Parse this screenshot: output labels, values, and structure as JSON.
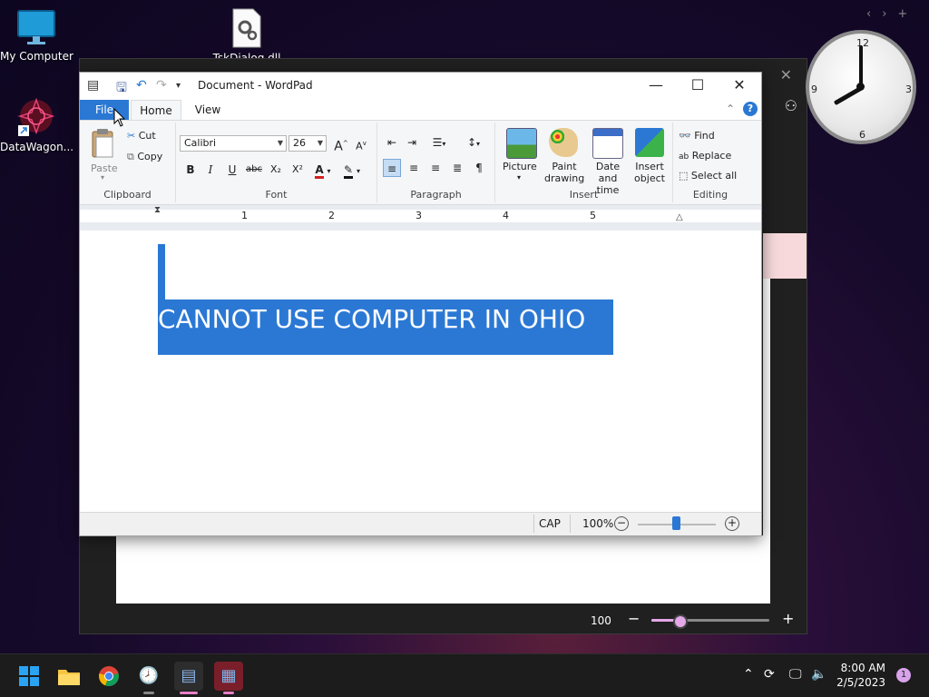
{
  "desktop": {
    "icons": [
      {
        "label": "My Computer"
      },
      {
        "label": "TskDialog.dll"
      },
      {
        "label": "DataWagon..."
      }
    ]
  },
  "background_window": {
    "zoom_value": "100",
    "minus": "−",
    "plus": "+",
    "close": "✕"
  },
  "clock_widget": {
    "numerals": [
      "12",
      "3",
      "6",
      "9"
    ],
    "nav_prev": "‹",
    "nav_next": "›",
    "nav_add": "+"
  },
  "wordpad": {
    "title": "Document - WordPad",
    "tabs": {
      "file": "File",
      "home": "Home",
      "view": "View"
    },
    "clipboard": {
      "paste": "Paste",
      "cut": "Cut",
      "copy": "Copy",
      "label": "Clipboard"
    },
    "font": {
      "family": "Calibri",
      "size": "26",
      "label": "Font",
      "bold": "B",
      "italic": "I",
      "underline": "U",
      "strike": "abc",
      "subscript": "X₂",
      "superscript": "X²",
      "grow": "A",
      "shrink": "A"
    },
    "paragraph": {
      "label": "Paragraph"
    },
    "insert": {
      "label": "Insert",
      "picture": "Picture",
      "paint": "Paint drawing",
      "datetime": "Date and time",
      "object": "Insert object"
    },
    "editing": {
      "label": "Editing",
      "find": "Find",
      "replace": "Replace",
      "select_all": "Select all"
    },
    "ruler": {
      "numbers": [
        "1",
        "2",
        "3",
        "4",
        "5"
      ]
    },
    "document_text": "CANNOT USE COMPUTER IN OHIO",
    "status": {
      "caps": "CAP",
      "zoom": "100%"
    }
  },
  "taskbar": {
    "time": "8:00 AM",
    "date": "2/5/2023",
    "notification_count": "1"
  },
  "colors": {
    "accent": "#2b78d4",
    "taskbar": "#1c1c1c"
  }
}
